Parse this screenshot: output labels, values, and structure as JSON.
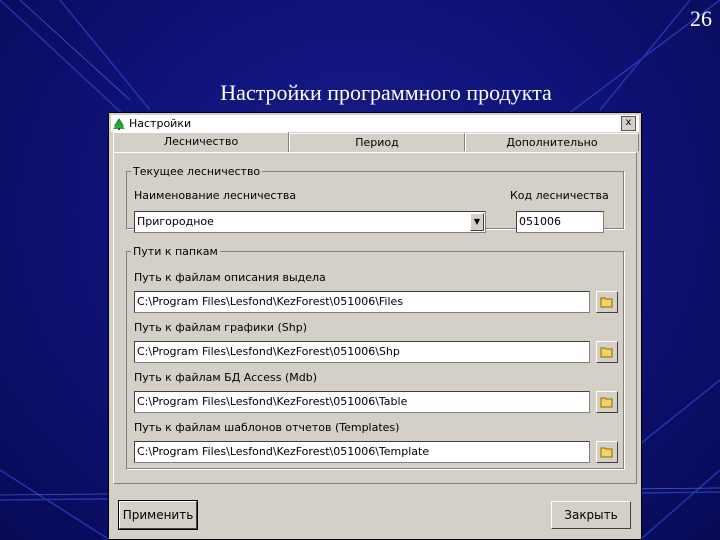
{
  "slide": {
    "number": "26",
    "title": "Настройки программного продукта"
  },
  "dialog": {
    "title": "Настройки",
    "icon": "tree-icon",
    "close_label": "x",
    "tabs": [
      {
        "label": "Лесничество",
        "active": true
      },
      {
        "label": "Период",
        "active": false
      },
      {
        "label": "Дополнительно",
        "active": false
      }
    ],
    "forestry_group": {
      "legend": "Текущее лесничество",
      "name_label": "Наименование лесничества",
      "name_value": "Пригородное",
      "code_label": "Код лесничества",
      "code_value": "051006"
    },
    "paths_group": {
      "legend": "Пути к папкам",
      "paths": [
        {
          "label": "Путь к файлам описания выдела",
          "value": "C:\\Program Files\\Lesfond\\KezForest\\051006\\Files"
        },
        {
          "label": "Путь к файлам графики (Shp)",
          "value": "C:\\Program Files\\Lesfond\\KezForest\\051006\\Shp"
        },
        {
          "label": "Путь к файлам БД Access (Mdb)",
          "value": "C:\\Program Files\\Lesfond\\KezForest\\051006\\Table"
        },
        {
          "label": "Путь к файлам шаблонов отчетов (Templates)",
          "value": "C:\\Program Files\\Lesfond\\KezForest\\051006\\Template"
        }
      ]
    },
    "buttons": {
      "apply": "Применить",
      "close": "Закрыть"
    }
  },
  "colors": {
    "background": "#10137a",
    "dialog_face": "#d4d0c8"
  }
}
